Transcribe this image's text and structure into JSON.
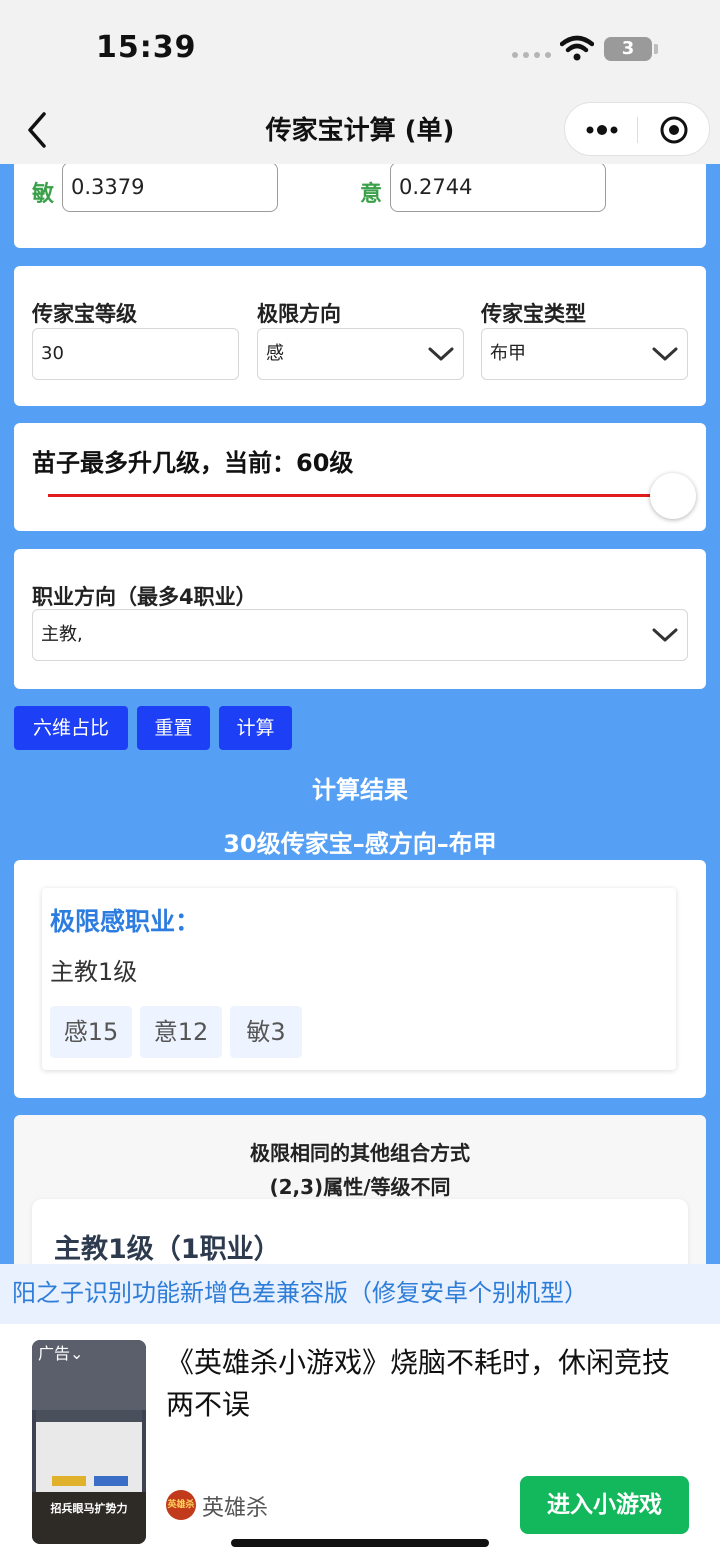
{
  "status": {
    "time": "15:39",
    "battery": "3"
  },
  "nav": {
    "title": "传家宝计算 (单)"
  },
  "attrs": {
    "min_label": "敏",
    "min_value": "0.3379",
    "yi_label": "意",
    "yi_value": "0.2744"
  },
  "settings": {
    "level_label": "传家宝等级",
    "level_value": "30",
    "direction_label": "极限方向",
    "direction_value": "感",
    "type_label": "传家宝类型",
    "type_value": "布甲"
  },
  "slider": {
    "title": "苗子最多升几级，当前：60级",
    "fraction": 1.0
  },
  "career": {
    "label": "职业方向（最多4职业）",
    "value": "主教,"
  },
  "buttons": {
    "six_dim": "六维占比",
    "reset": "重置",
    "calc": "计算"
  },
  "result": {
    "header": "计算结果",
    "subtitle": "30级传家宝–感方向–布甲",
    "limit_title": "极限感职业：",
    "limit_desc": "主教1级",
    "tags": [
      "感15",
      "意12",
      "敏3"
    ]
  },
  "other": {
    "line1": "极限相同的其他组合方式",
    "line2": "(2,3)属性/等级不同",
    "combo_title": "主教1级（1职业）"
  },
  "marquee": "阳之子识别功能新增色差兼容版（修复安卓个别机型）",
  "ad": {
    "label": "广告",
    "thumb_caption": "招兵眼马扩势力",
    "text": "《英雄杀小游戏》烧脑不耗时，休闲竞技两不误",
    "logo_text": "英雄杀",
    "brand": "英雄杀",
    "cta": "进入小游戏"
  }
}
